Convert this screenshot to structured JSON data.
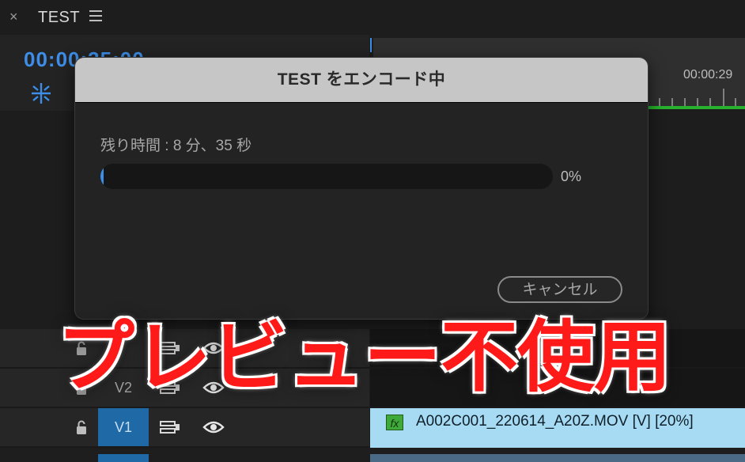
{
  "header": {
    "close_glyph": "×",
    "sequence_title": "TEST",
    "menu_icon": "hamburger-menu-icon"
  },
  "timeline": {
    "timecode": "00:00:35:00",
    "ruler_time": "00:00:29",
    "tracks": [
      {
        "label": "",
        "active": false
      },
      {
        "label": "V2",
        "active": false
      },
      {
        "label": "V1",
        "active": true
      }
    ],
    "clip": {
      "fx_label": "fx",
      "name": "A002C001_220614_A20Z.MOV [V] [20%]"
    },
    "colors": {
      "accent_blue": "#3d8ee8",
      "render_bar_green": "#27b12e",
      "clip_color": "#a7dbf3"
    }
  },
  "dialog": {
    "title": "TEST をエンコード中",
    "remaining_text": "残り時間 : 8 分、35 秒",
    "progress_percent": 0,
    "progress_label": "0%",
    "cancel_label": "キャンセル"
  },
  "overlay": {
    "banner_text": "プレビュー不使用",
    "color": "#ff1a1a"
  }
}
